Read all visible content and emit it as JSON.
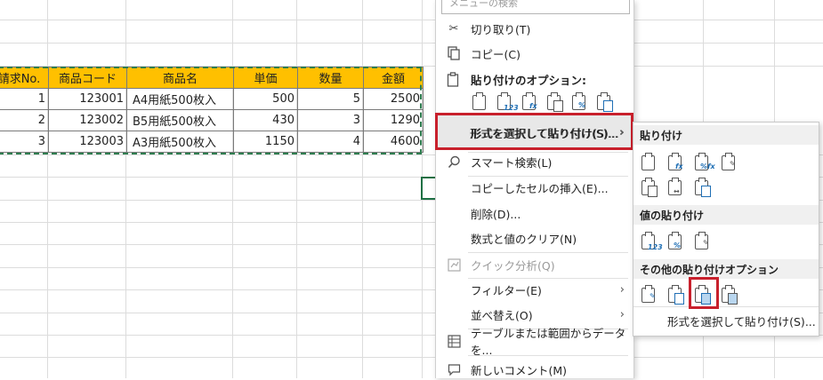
{
  "sheet": {
    "headers": [
      "請求No.",
      "商品コード",
      "商品名",
      "単価",
      "数量",
      "金額"
    ],
    "rows": [
      [
        "1",
        "123001",
        "A4用紙500枚入",
        "500",
        "5",
        "2500"
      ],
      [
        "2",
        "123002",
        "B5用紙500枚入",
        "430",
        "3",
        "1290"
      ],
      [
        "3",
        "123003",
        "A3用紙500枚入",
        "1150",
        "4",
        "4600"
      ]
    ],
    "header_color": "#ffc000"
  },
  "menu": {
    "search_placeholder": "メニューの検索",
    "cut": "切り取り(T)",
    "copy": "コピー(C)",
    "paste_options": "貼り付けのオプション:",
    "paste_special": "形式を選択して貼り付け(S)...",
    "smart_lookup": "スマート検索(L)",
    "insert_copied": "コピーしたセルの挿入(E)...",
    "delete": "削除(D)...",
    "clear_contents": "数式と値のクリア(N)",
    "quick_analysis": "クイック分析(Q)",
    "filter": "フィルター(E)",
    "sort": "並べ替え(O)",
    "table_range": "テーブルまたは範囲からデータを...",
    "new_comment": "新しいコメント(M)"
  },
  "submenu": {
    "paste_header": "貼り付け",
    "values_header": "値の貼り付け",
    "other_header": "その他の貼り付けオプション",
    "footer": "形式を選択して貼り付け(S)..."
  },
  "highlight_color": "#c8202c"
}
